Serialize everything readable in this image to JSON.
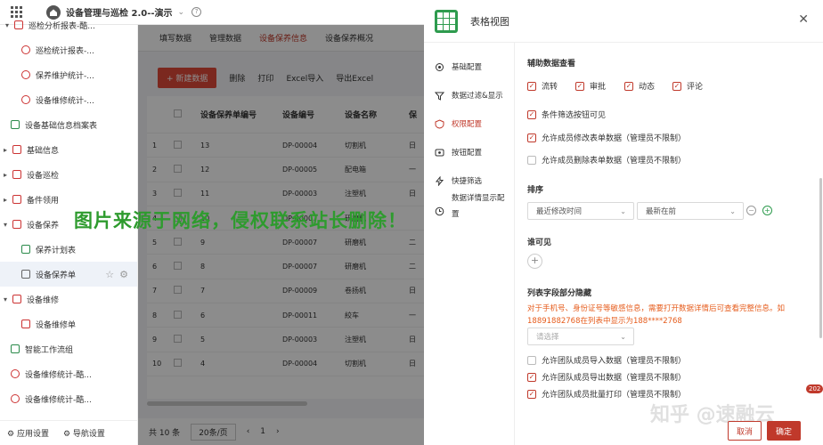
{
  "header": {
    "app_title": "设备管理与巡检 2.0--演示"
  },
  "sidebar": {
    "items": [
      {
        "label": "巡检分析报表-酷..."
      },
      {
        "label": "巡检统计报表-..."
      },
      {
        "label": "保养维护统计-..."
      },
      {
        "label": "设备维修统计-..."
      },
      {
        "label": "设备基础信息档案表"
      },
      {
        "label": "基础信息"
      },
      {
        "label": "设备巡检"
      },
      {
        "label": "备件领用"
      },
      {
        "label": "设备保养"
      },
      {
        "label": "保养计划表"
      },
      {
        "label": "设备保养单"
      },
      {
        "label": "设备维修"
      },
      {
        "label": "设备维修单"
      },
      {
        "label": "智能工作流组"
      },
      {
        "label": "设备维修统计-酷..."
      },
      {
        "label": "设备维修统计-酷..."
      }
    ],
    "app_settings": "应用设置",
    "nav_settings": "导航设置"
  },
  "main": {
    "tabs": [
      "填写数据",
      "管理数据",
      "设备保养信息",
      "设备保养概况"
    ],
    "toolbar": {
      "new": "+ 新建数据",
      "delete": "删除",
      "print": "打印",
      "excel_import": "Excel导入",
      "export": "导出Excel"
    },
    "columns": [
      "设备保养单编号",
      "设备编号",
      "设备名称",
      "保"
    ],
    "rows": [
      {
        "n": "1",
        "id": "13",
        "dev": "DP-00004",
        "name": "切割机",
        "x": "日"
      },
      {
        "n": "2",
        "id": "12",
        "dev": "DP-00005",
        "name": "配电箱",
        "x": "一"
      },
      {
        "n": "3",
        "id": "11",
        "dev": "DP-00003",
        "name": "注塑机",
        "x": "日"
      },
      {
        "n": "4",
        "id": "10",
        "dev": "DP-00007",
        "name": "研磨机",
        "x": ""
      },
      {
        "n": "5",
        "id": "9",
        "dev": "DP-00007",
        "name": "研磨机",
        "x": "二"
      },
      {
        "n": "6",
        "id": "8",
        "dev": "DP-00007",
        "name": "研磨机",
        "x": "二"
      },
      {
        "n": "7",
        "id": "7",
        "dev": "DP-00009",
        "name": "卷扬机",
        "x": "日"
      },
      {
        "n": "8",
        "id": "6",
        "dev": "DP-00011",
        "name": "絞车",
        "x": "一"
      },
      {
        "n": "9",
        "id": "5",
        "dev": "DP-00003",
        "name": "注塑机",
        "x": "日"
      },
      {
        "n": "10",
        "id": "4",
        "dev": "DP-00004",
        "name": "切割机",
        "x": "日"
      }
    ],
    "total": "共 10 条",
    "page_size": "20条/页",
    "page": "1"
  },
  "watermark": "图片来源于网络，侵权联系站长删除！",
  "panel": {
    "title": "表格视图",
    "nav": [
      "基础配置",
      "数据过滤&显示",
      "权限配置",
      "按钮配置",
      "快捷筛选",
      "数据详情显示配置"
    ],
    "aux_title": "辅助数据查看",
    "aux": [
      "流转",
      "审批",
      "动态",
      "评论"
    ],
    "cond_filter": "条件筛选按钮可见",
    "allow_edit": "允许成员修改表单数据（管理员不限制）",
    "allow_delete": "允许成员删除表单数据（管理员不限制）",
    "sort_title": "排序",
    "sort_field": "最近修改时间",
    "sort_order": "最新在前",
    "visible_title": "谁可见",
    "hide_title": "列表字段部分隐藏",
    "hide_note": "对于手机号、身份证号等敏感信息，需要打开数据详情后可查看完整信息。如18891882768在列表中显示为188****2768",
    "select_placeholder": "请选择",
    "team_import": "允许团队成员导入数据（管理员不限制）",
    "team_export": "允许团队成员导出数据（管理员不限制）",
    "team_print": "允许团队成员批量打印（管理员不限制）",
    "cancel": "取消",
    "ok": "确定",
    "zhihu": "知乎 @速融云",
    "badge": "202"
  }
}
